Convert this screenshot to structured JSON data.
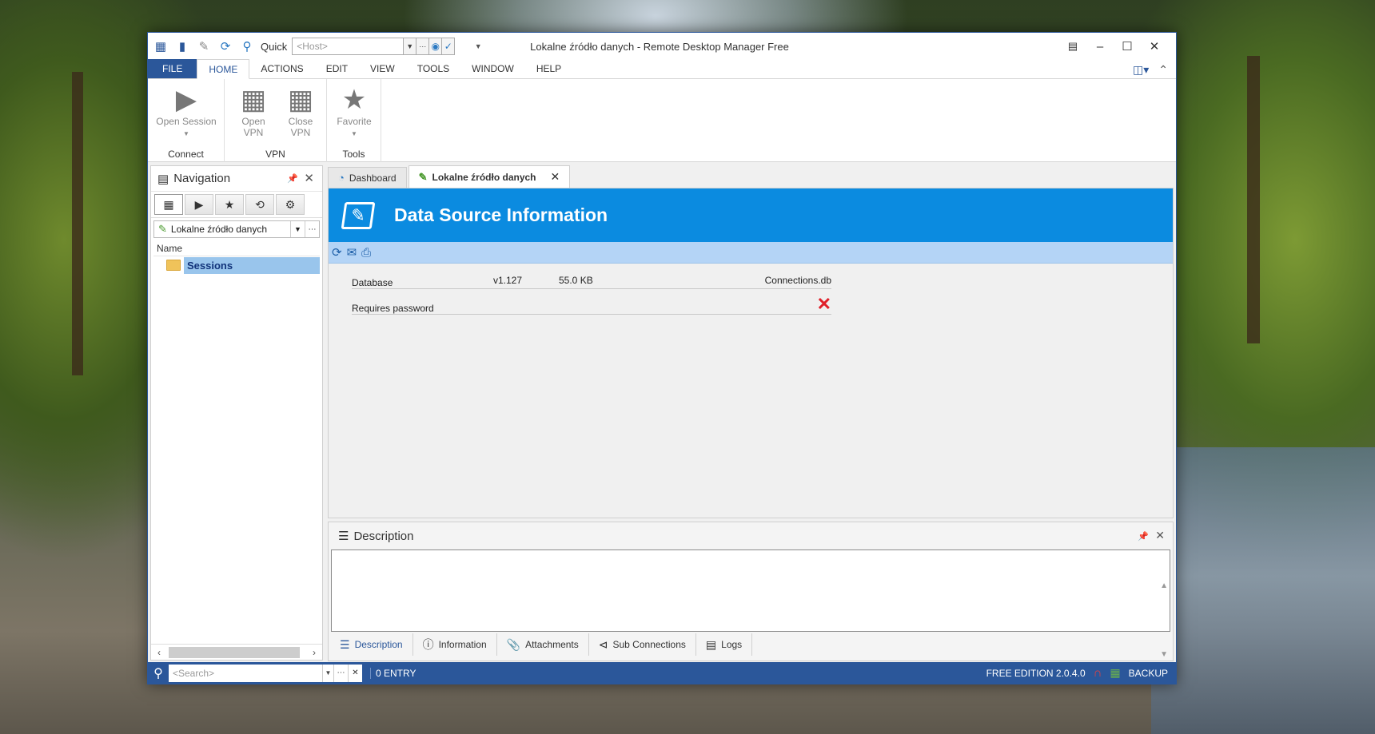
{
  "window": {
    "title": "Lokalne źródło danych - Remote Desktop Manager Free"
  },
  "quick_access": {
    "quick_label": "Quick",
    "host_placeholder": "<Host>"
  },
  "ribbon": {
    "tabs": [
      "FILE",
      "HOME",
      "ACTIONS",
      "EDIT",
      "VIEW",
      "TOOLS",
      "WINDOW",
      "HELP"
    ],
    "active_tab": "HOME",
    "groups": {
      "connect": {
        "label": "Connect",
        "open_session": "Open Session"
      },
      "vpn": {
        "label": "VPN",
        "open_vpn": "Open VPN",
        "close_vpn": "Close VPN"
      },
      "tools": {
        "label": "Tools",
        "favorite": "Favorite"
      }
    }
  },
  "navigation": {
    "title": "Navigation",
    "datasource": "Lokalne źródło danych",
    "column_name": "Name",
    "tree": [
      {
        "label": "Sessions",
        "selected": true
      }
    ]
  },
  "doc_tabs": [
    {
      "label": "Dashboard",
      "active": false
    },
    {
      "label": "Lokalne źródło danych",
      "active": true
    }
  ],
  "content": {
    "banner_title": "Data Source Information",
    "rows": [
      {
        "label": "Database",
        "version": "v1.127",
        "size": "55.0 KB",
        "file": "Connections.db"
      },
      {
        "label": "Requires password",
        "value_icon": "red-x-icon"
      }
    ]
  },
  "description": {
    "title": "Description",
    "text": "",
    "tabs": [
      "Description",
      "Information",
      "Attachments",
      "Sub Connections",
      "Logs"
    ],
    "active_tab": "Description"
  },
  "statusbar": {
    "search_placeholder": "<Search>",
    "entry_count": "0 ENTRY",
    "edition": "FREE EDITION 2.0.4.0",
    "backup": "BACKUP"
  },
  "colors": {
    "accent": "#2b579a",
    "banner": "#0b8be0",
    "subbar": "#b4d4f6",
    "selection": "#99c5ec",
    "error": "#e0202a"
  }
}
